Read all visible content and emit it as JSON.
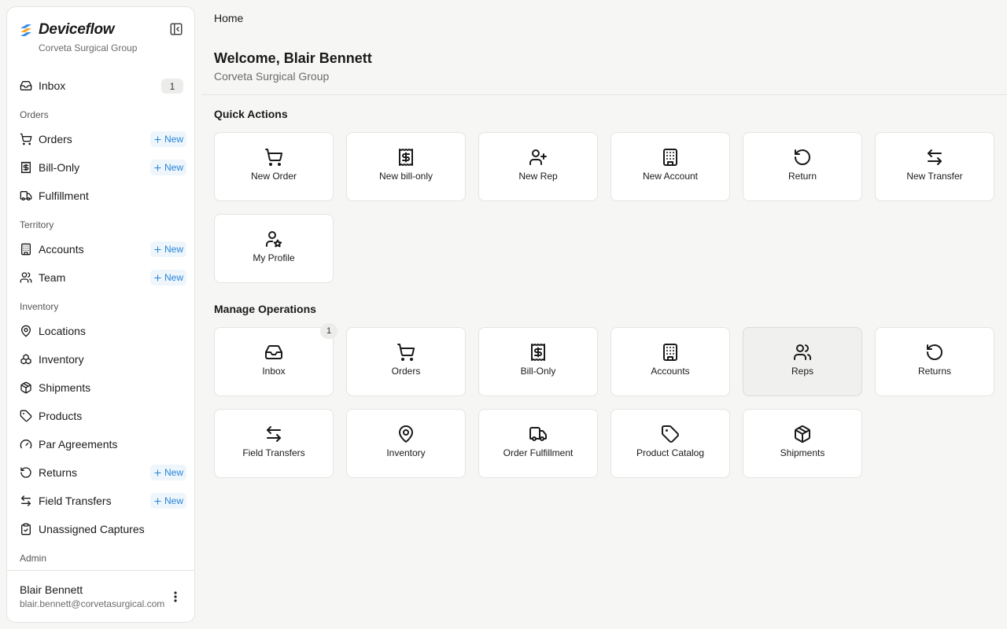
{
  "sidebar": {
    "brand_name": "Deviceflow",
    "org_name": "Corveta Surgical Group",
    "inbox": {
      "label": "Inbox",
      "count": "1"
    },
    "sections": {
      "orders": "Orders",
      "territory": "Territory",
      "inventory": "Inventory",
      "admin": "Admin"
    },
    "items": {
      "orders": "Orders",
      "bill_only": "Bill-Only",
      "fulfillment": "Fulfillment",
      "accounts": "Accounts",
      "team": "Team",
      "locations": "Locations",
      "inventory": "Inventory",
      "shipments": "Shipments",
      "products": "Products",
      "par_agreements": "Par Agreements",
      "returns": "Returns",
      "field_transfers": "Field Transfers",
      "unassigned_captures": "Unassigned Captures"
    },
    "new_label": "New",
    "user": {
      "name": "Blair Bennett",
      "email": "blair.bennett@corvetasurgical.com"
    }
  },
  "main": {
    "breadcrumb": "Home",
    "title": "Welcome, Blair Bennett",
    "subtitle": "Corveta Surgical Group",
    "quick_actions_title": "Quick Actions",
    "quick_actions": {
      "new_order": "New Order",
      "new_bill_only": "New bill-only",
      "new_rep": "New Rep",
      "new_account": "New Account",
      "return": "Return",
      "new_transfer": "New Transfer",
      "my_profile": "My Profile"
    },
    "manage_title": "Manage Operations",
    "manage": {
      "inbox": "Inbox",
      "inbox_badge": "1",
      "orders": "Orders",
      "bill_only": "Bill-Only",
      "accounts": "Accounts",
      "reps": "Reps",
      "returns": "Returns",
      "field_transfers": "Field Transfers",
      "inventory": "Inventory",
      "order_fulfillment": "Order Fulfillment",
      "product_catalog": "Product Catalog",
      "shipments": "Shipments"
    }
  },
  "colors": {
    "accent": "#2684d8",
    "new_badge_bg": "#eef6fc",
    "logo_blue": "#3b8ee8",
    "logo_orange": "#f5a623"
  },
  "icons": {
    "inbox": "inbox-icon",
    "cart": "cart-icon",
    "receipt": "receipt-dollar-icon",
    "truck": "truck-icon",
    "building": "building-icon",
    "users": "users-icon",
    "user_plus": "user-plus-icon",
    "map_pin": "map-pin-icon",
    "boxes": "boxes-icon",
    "package": "package-icon",
    "tag": "tag-icon",
    "gauge": "gauge-icon",
    "rotate": "rotate-ccw-icon",
    "arrows": "arrow-left-right-icon",
    "clipboard": "clipboard-check-icon",
    "user_star": "user-star-icon"
  }
}
